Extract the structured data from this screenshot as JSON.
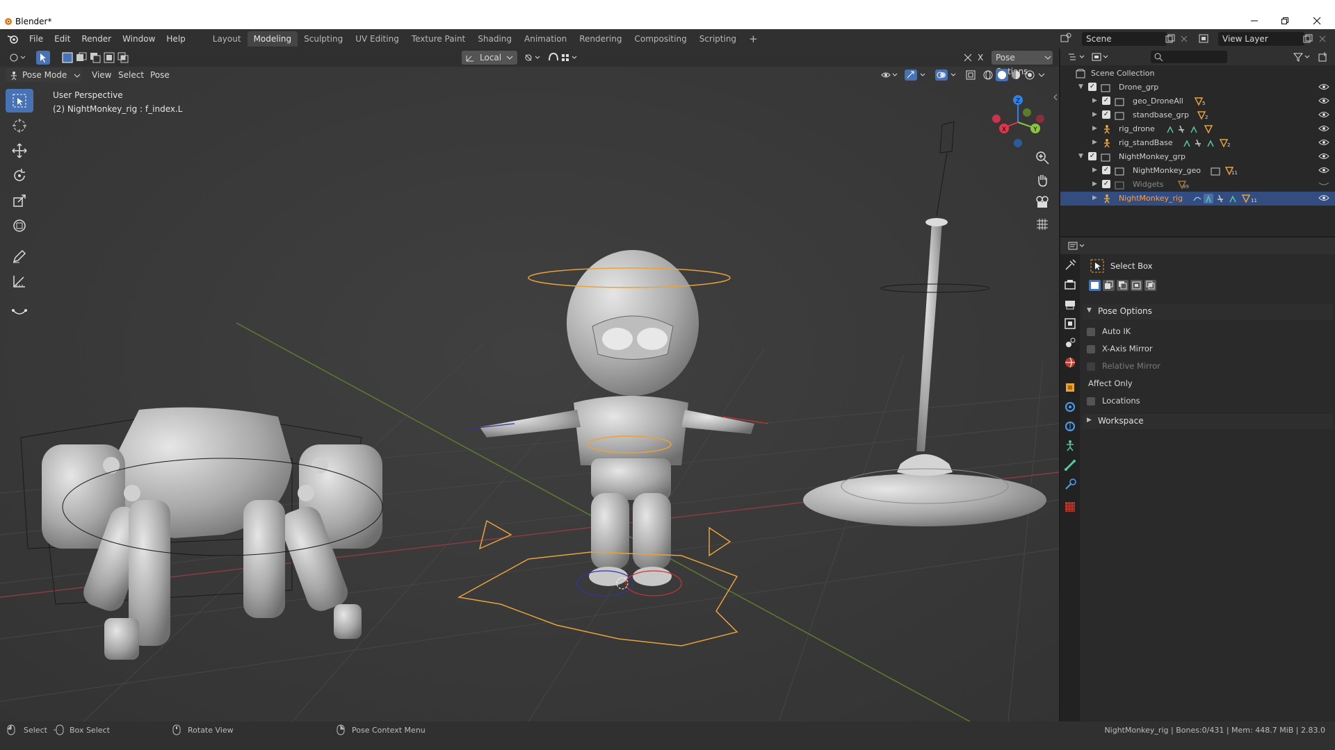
{
  "window": {
    "title": "Blender*"
  },
  "menu": [
    "File",
    "Edit",
    "Render",
    "Window",
    "Help"
  ],
  "workspaces": [
    "Layout",
    "Modeling",
    "Sculpting",
    "UV Editing",
    "Texture Paint",
    "Shading",
    "Animation",
    "Rendering",
    "Compositing",
    "Scripting"
  ],
  "workspace_active": "Modeling",
  "scene": {
    "name": "Scene",
    "view_layer": "View Layer"
  },
  "viewport": {
    "mode": "Pose Mode",
    "menus": [
      "View",
      "Select",
      "Pose"
    ],
    "transform_orientation": "Local",
    "pose_options_label": "Pose Options",
    "x_mirror_label": "X",
    "perspective": "User Perspective",
    "active_info": "(2) NightMonkey_rig : f_index.L",
    "axes": {
      "x": "X",
      "y": "Y",
      "z": "Z"
    }
  },
  "outliner": {
    "root": "Scene Collection",
    "items": [
      {
        "label": "Drone_grp",
        "badge": ""
      },
      {
        "label": "geo_DroneAll",
        "badge": "5"
      },
      {
        "label": "standbase_grp",
        "badge": "2"
      },
      {
        "label": "rig_drone",
        "badge": ""
      },
      {
        "label": "rig_standBase",
        "badge": "2"
      },
      {
        "label": "NightMonkey_grp",
        "badge": ""
      },
      {
        "label": "NightMonkey_geo",
        "badge": "11"
      },
      {
        "label": "Widgets",
        "badge": "99"
      },
      {
        "label": "NightMonkey_rig",
        "badge": "11"
      }
    ]
  },
  "properties": {
    "tool_name": "Select Box",
    "panel_pose_options": "Pose Options",
    "auto_ik": "Auto IK",
    "x_axis_mirror": "X-Axis Mirror",
    "relative_mirror": "Relative Mirror",
    "affect_only": "Affect Only",
    "locations": "Locations",
    "panel_workspace": "Workspace"
  },
  "statusbar": {
    "select": "Select",
    "box_select": "Box Select",
    "rotate_view": "Rotate View",
    "context_menu": "Pose Context Menu",
    "stats": "NightMonkey_rig | Bones:0/431 | Mem: 448.7 MiB | 2.83.0"
  },
  "colors": {
    "accent": "#4772b3",
    "selection_row": "#334d80",
    "bone_orange": "#e8a33a",
    "axis_x": "#e5334e",
    "axis_y": "#8bc43f",
    "axis_z": "#2f83e6"
  }
}
